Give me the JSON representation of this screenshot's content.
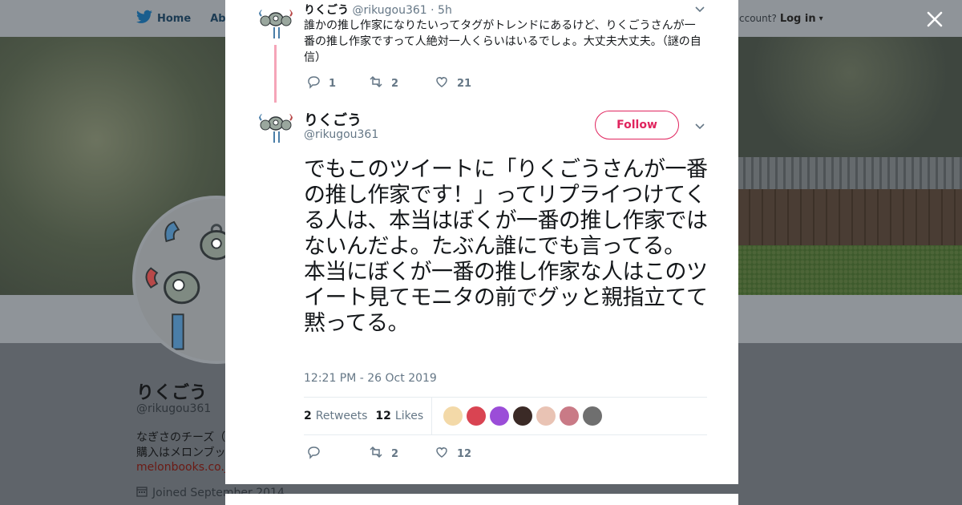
{
  "background_page": {
    "nav": {
      "home_label": "Home",
      "about_label": "Abo",
      "account_text": "ccount?",
      "login_label": "Log in"
    },
    "profile": {
      "name": "りくごう",
      "handle": "@rikugou361",
      "bio_line1": "なぎさのチーズ（",
      "bio_line2": "購入はメロンブッ",
      "link": "melonbooks.co.jp",
      "joined": "Joined September 2014"
    }
  },
  "modal": {
    "parent_tweet": {
      "name": "りくごう",
      "handle": "@rikugou361",
      "time": "· 5h",
      "text": "誰かの推し作家になりたいってタグがトレンドにあるけど、りくごうさんが一番の推し作家ですって人絶対一人くらいはいるでしょ。大丈夫大丈夫。（謎の自信）",
      "replies": "1",
      "retweets": "2",
      "likes": "21"
    },
    "main_tweet": {
      "name": "りくごう",
      "handle": "@rikugou361",
      "follow_label": "Follow",
      "text": "でもこのツイートに「りくごうさんが一番の推し作家です！」ってリプライつけてくる人は、本当はぼくが一番の推し作家ではないんだよ。たぶん誰にでも言ってる。\n本当にぼくが一番の推し作家な人はこのツイート見てモニタの前でグッと親指立てて黙ってる。",
      "timestamp": "12:21 PM - 26 Oct 2019",
      "retweets_count": "2",
      "retweets_label": "Retweets",
      "likes_count": "12",
      "likes_label": "Likes",
      "action_retweets": "2",
      "action_likes": "12"
    }
  },
  "colors": {
    "follow_accent": "#e0245e",
    "thread_line": "#f5a5b8",
    "muted_text": "#657786",
    "twitter_blue": "#1da1f2"
  },
  "liker_colors": [
    "#f3d9a8",
    "#d94452",
    "#9b4dd8",
    "#3b2a26",
    "#e9c3b4",
    "#c97a86",
    "#6f6f6f"
  ]
}
